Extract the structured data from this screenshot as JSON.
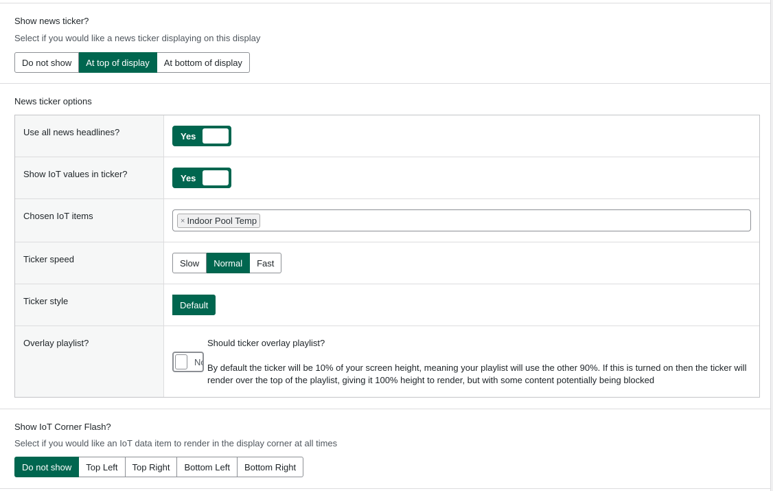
{
  "news_ticker": {
    "title": "Show news ticker?",
    "description": "Select if you would like a news ticker displaying on this display",
    "options": [
      "Do not show",
      "At top of display",
      "At bottom of display"
    ],
    "selected": "At top of display"
  },
  "ticker_options": {
    "title": "News ticker options",
    "rows": {
      "use_all_headlines": {
        "label": "Use all news headlines?",
        "value": "Yes"
      },
      "show_iot_values": {
        "label": "Show IoT values in ticker?",
        "value": "Yes"
      },
      "chosen_iot_items": {
        "label": "Chosen IoT items",
        "tags": [
          "Indoor Pool Temp"
        ],
        "remove_glyph": "×"
      },
      "ticker_speed": {
        "label": "Ticker speed",
        "options": [
          "Slow",
          "Normal",
          "Fast"
        ],
        "selected": "Normal"
      },
      "ticker_style": {
        "label": "Ticker style",
        "options": [
          "Default"
        ],
        "selected": "Default"
      },
      "overlay_playlist": {
        "label": "Overlay playlist?",
        "value": "No",
        "visible_value": "Nc",
        "title": "Should ticker overlay playlist?",
        "description": "By default the ticker will be 10% of your screen height, meaning your playlist will use the other 90%. If this is turned on then the ticker will render over the top of the playlist, giving it 100% height to render, but with some content potentially being blocked"
      }
    }
  },
  "corner_flash": {
    "title": "Show IoT Corner Flash?",
    "description": "Select if you would like an IoT data item to render in the display corner at all times",
    "options": [
      "Do not show",
      "Top Left",
      "Top Right",
      "Bottom Left",
      "Bottom Right"
    ],
    "selected": "Do not show"
  },
  "colors": {
    "accent": "#00664f",
    "border": "#8c8f94",
    "label_bg": "#f6f7f7"
  }
}
